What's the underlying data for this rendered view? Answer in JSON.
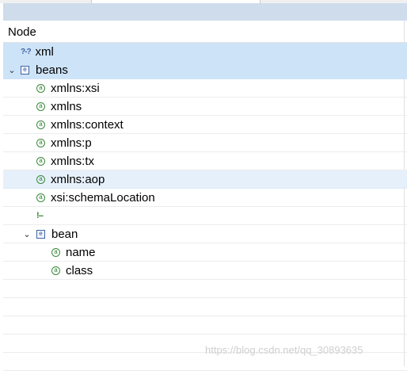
{
  "header": {
    "column_label": "Node"
  },
  "tree": [
    {
      "label": "xml",
      "icon": "processing-instruction-icon",
      "glyph": "?-?"
    },
    {
      "label": "beans",
      "icon": "element-icon",
      "glyph": "e",
      "expanded": true
    },
    {
      "label": "xmlns:xsi",
      "icon": "attribute-icon",
      "glyph": "a"
    },
    {
      "label": "xmlns",
      "icon": "attribute-icon",
      "glyph": "a"
    },
    {
      "label": "xmlns:context",
      "icon": "attribute-icon",
      "glyph": "a"
    },
    {
      "label": "xmlns:p",
      "icon": "attribute-icon",
      "glyph": "a"
    },
    {
      "label": "xmlns:tx",
      "icon": "attribute-icon",
      "glyph": "a"
    },
    {
      "label": "xmlns:aop",
      "icon": "attribute-icon",
      "glyph": "a"
    },
    {
      "label": "xsi:schemaLocation",
      "icon": "attribute-icon",
      "glyph": "a"
    },
    {
      "label": "",
      "icon": "comment-icon",
      "glyph": "!--"
    },
    {
      "label": "bean",
      "icon": "element-icon",
      "glyph": "e",
      "expanded": true
    },
    {
      "label": "name",
      "icon": "attribute-icon",
      "glyph": "a"
    },
    {
      "label": "class",
      "icon": "attribute-icon",
      "glyph": "a"
    }
  ],
  "watermark": "https://blog.csdn.net/qq_30893635",
  "colors": {
    "selection": "#cde3f7",
    "hover": "#e6f0fb",
    "tab_bar": "#cfdcec",
    "attribute_icon": "#2e7d32",
    "element_icon": "#2a4f96"
  }
}
